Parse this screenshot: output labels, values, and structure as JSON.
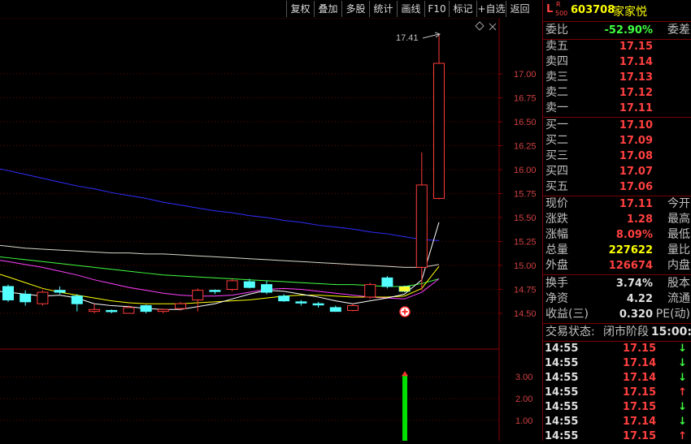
{
  "toolbar": {
    "buttons": [
      "复权",
      "叠加",
      "多股",
      "统计",
      "画线",
      "F10",
      "标记",
      "+自选",
      "返回"
    ]
  },
  "chart": {
    "peak_label": "17.41",
    "price_axis": [
      "17.00",
      "16.75",
      "16.50",
      "16.25",
      "16.00",
      "15.75",
      "15.50",
      "15.25",
      "15.00",
      "14.75",
      "14.50"
    ],
    "volume_axis": [
      "3.00",
      "2.00",
      "1.00"
    ],
    "colors": {
      "up": "#ff3b3b",
      "down": "#54ffff",
      "ma5": "#ffffff",
      "ma10": "#ffff00",
      "ma20": "#ff40ff",
      "ma30": "#40ff40",
      "ma60": "#d8d8c8",
      "ma120": "#2f2fff",
      "volume": "#00e000"
    }
  },
  "chart_data": {
    "type": "candlestick",
    "candles": [
      {
        "o": 14.78,
        "c": 14.64,
        "h": 14.8,
        "l": 14.62
      },
      {
        "o": 14.7,
        "c": 14.62,
        "h": 14.74,
        "l": 14.58
      },
      {
        "o": 14.6,
        "c": 14.72,
        "h": 14.74,
        "l": 14.58
      },
      {
        "o": 14.74,
        "c": 14.72,
        "h": 14.78,
        "l": 14.7
      },
      {
        "o": 14.68,
        "c": 14.6,
        "h": 14.7,
        "l": 14.52
      },
      {
        "o": 14.52,
        "c": 14.54,
        "h": 14.6,
        "l": 14.5
      },
      {
        "o": 14.53,
        "c": 14.52,
        "h": 14.54,
        "l": 14.5
      },
      {
        "o": 14.5,
        "c": 14.56,
        "h": 14.58,
        "l": 14.5
      },
      {
        "o": 14.58,
        "c": 14.52,
        "h": 14.59,
        "l": 14.5
      },
      {
        "o": 14.52,
        "c": 14.54,
        "h": 14.55,
        "l": 14.5
      },
      {
        "o": 14.55,
        "c": 14.6,
        "h": 14.62,
        "l": 14.53
      },
      {
        "o": 14.64,
        "c": 14.74,
        "h": 14.76,
        "l": 14.52
      },
      {
        "o": 14.74,
        "c": 14.73,
        "h": 14.75,
        "l": 14.7
      },
      {
        "o": 14.75,
        "c": 14.84,
        "h": 14.86,
        "l": 14.73
      },
      {
        "o": 14.83,
        "c": 14.77,
        "h": 14.86,
        "l": 14.76
      },
      {
        "o": 14.8,
        "c": 14.72,
        "h": 14.84,
        "l": 14.7
      },
      {
        "o": 14.68,
        "c": 14.63,
        "h": 14.7,
        "l": 14.62
      },
      {
        "o": 14.62,
        "c": 14.61,
        "h": 14.64,
        "l": 14.58
      },
      {
        "o": 14.6,
        "c": 14.59,
        "h": 14.62,
        "l": 14.56
      },
      {
        "o": 14.56,
        "c": 14.52,
        "h": 14.58,
        "l": 14.52
      },
      {
        "o": 14.53,
        "c": 14.58,
        "h": 14.6,
        "l": 14.52
      },
      {
        "o": 14.67,
        "c": 14.8,
        "h": 14.82,
        "l": 14.65
      },
      {
        "o": 14.87,
        "c": 14.78,
        "h": 14.89,
        "l": 14.76
      },
      {
        "o": 14.78,
        "c": 14.73,
        "h": 14.79,
        "l": 14.72
      },
      {
        "o": 14.98,
        "c": 15.84,
        "h": 16.18,
        "l": 14.74
      },
      {
        "o": 15.7,
        "c": 17.11,
        "h": 17.41,
        "l": 15.69
      }
    ],
    "ma5": [
      14.72,
      14.7,
      14.68,
      14.69,
      14.66,
      14.6,
      14.58,
      14.57,
      14.55,
      14.54,
      14.54,
      14.57,
      14.6,
      14.65,
      14.7,
      14.74,
      14.73,
      14.7,
      14.67,
      14.63,
      14.6,
      14.63,
      14.66,
      14.7,
      14.85,
      15.45
    ],
    "ma10": [
      14.88,
      14.82,
      14.76,
      14.72,
      14.69,
      14.66,
      14.63,
      14.61,
      14.6,
      14.6,
      14.6,
      14.61,
      14.62,
      14.63,
      14.64,
      14.66,
      14.68,
      14.69,
      14.69,
      14.68,
      14.67,
      14.67,
      14.67,
      14.68,
      14.76,
      14.99
    ],
    "ma20": [
      15.04,
      15.01,
      14.98,
      14.94,
      14.9,
      14.85,
      14.81,
      14.77,
      14.74,
      14.71,
      14.69,
      14.68,
      14.68,
      14.69,
      14.72,
      14.75,
      14.76,
      14.75,
      14.73,
      14.71,
      14.69,
      14.67,
      14.66,
      14.65,
      14.72,
      14.86
    ],
    "ma30": [
      15.08,
      15.06,
      15.04,
      15.02,
      15.0,
      14.98,
      14.96,
      14.94,
      14.92,
      14.9,
      14.89,
      14.88,
      14.87,
      14.86,
      14.85,
      14.84,
      14.83,
      14.82,
      14.81,
      14.8,
      14.8,
      14.79,
      14.78,
      14.78,
      14.81,
      14.86
    ],
    "ma60": [
      15.2,
      15.18,
      15.17,
      15.16,
      15.15,
      15.14,
      15.13,
      15.13,
      15.12,
      15.12,
      15.11,
      15.1,
      15.09,
      15.08,
      15.07,
      15.06,
      15.05,
      15.04,
      15.03,
      15.02,
      15.01,
      15.0,
      14.99,
      14.98,
      14.98,
      15.01
    ],
    "ma120": [
      15.99,
      15.95,
      15.91,
      15.87,
      15.83,
      15.8,
      15.76,
      15.73,
      15.7,
      15.66,
      15.63,
      15.6,
      15.57,
      15.55,
      15.52,
      15.5,
      15.47,
      15.45,
      15.42,
      15.4,
      15.38,
      15.35,
      15.33,
      15.3,
      15.27,
      15.26
    ],
    "volume": [
      0,
      0,
      0,
      0,
      0,
      0,
      0,
      0,
      0,
      0,
      0,
      0,
      0,
      0,
      0,
      0,
      0,
      0,
      0,
      0,
      0,
      0,
      3.1,
      0,
      0,
      0
    ],
    "ylim": [
      14.38,
      17.5
    ]
  },
  "quote": {
    "header": {
      "l": "L",
      "r": "R",
      "r500": "500",
      "code": "603708",
      "name": "家家悦"
    },
    "weibi": {
      "label": "委比",
      "value": "-52.90%",
      "label2": "委差",
      "color": "#40ff40"
    },
    "asks": [
      {
        "label": "卖五",
        "price": "17.15"
      },
      {
        "label": "卖四",
        "price": "17.14"
      },
      {
        "label": "卖三",
        "price": "17.13"
      },
      {
        "label": "卖二",
        "price": "17.12"
      },
      {
        "label": "卖一",
        "price": "17.11"
      }
    ],
    "bids": [
      {
        "label": "买一",
        "price": "17.10"
      },
      {
        "label": "买二",
        "price": "17.09"
      },
      {
        "label": "买三",
        "price": "17.08"
      },
      {
        "label": "买四",
        "price": "17.07"
      },
      {
        "label": "买五",
        "price": "17.06"
      }
    ],
    "stats": [
      {
        "label": "现价",
        "value": "17.11",
        "label2": "今开",
        "color": "#ff4040"
      },
      {
        "label": "涨跌",
        "value": "1.28",
        "label2": "最高",
        "color": "#ff4040"
      },
      {
        "label": "涨幅",
        "value": "8.09%",
        "label2": "最低",
        "color": "#ff4040"
      },
      {
        "label": "总量",
        "value": "227622",
        "label2": "量比",
        "color": "#ffff00"
      },
      {
        "label": "外盘",
        "value": "126674",
        "label2": "内盘",
        "color": "#ff4040"
      }
    ],
    "stats2": [
      {
        "label": "换手",
        "value": "3.74%",
        "label2": "股本",
        "color": "#e0e0e0"
      },
      {
        "label": "净资",
        "value": "4.22",
        "label2": "流通",
        "color": "#e0e0e0"
      },
      {
        "label": "收益(三)",
        "value": "0.320",
        "label2": "PE(动)",
        "color": "#e0e0e0"
      }
    ],
    "trade_status": {
      "label": "交易状态:",
      "value": "闭市阶段",
      "time": "15:00:"
    },
    "ticks": [
      {
        "time": "14:55",
        "price": "17.15",
        "arrow": "↓",
        "color": "#40ff40"
      },
      {
        "time": "14:55",
        "price": "17.14",
        "arrow": "↓",
        "color": "#40ff40"
      },
      {
        "time": "14:55",
        "price": "17.14",
        "arrow": "↓",
        "color": "#40ff40"
      },
      {
        "time": "14:55",
        "price": "17.15",
        "arrow": "↑",
        "color": "#ff4040"
      },
      {
        "time": "14:55",
        "price": "17.15",
        "arrow": "↓",
        "color": "#40ff40"
      },
      {
        "time": "14:55",
        "price": "17.14",
        "arrow": "↓",
        "color": "#40ff40"
      },
      {
        "time": "14:55",
        "price": "17.15",
        "arrow": "↑",
        "color": "#ff4040"
      }
    ]
  }
}
